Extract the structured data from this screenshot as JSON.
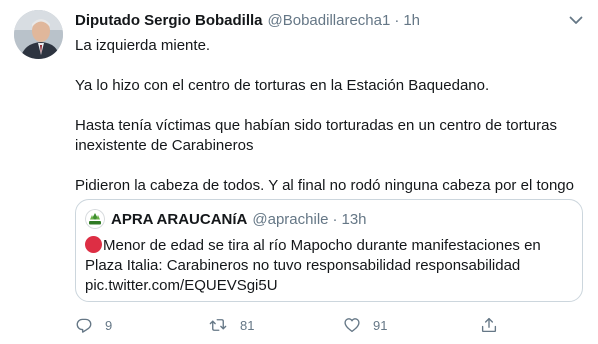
{
  "tweet": {
    "author_name": "Diputado Sergio Bobadilla",
    "author_handle": "@Bobadillarecha1",
    "separator": "·",
    "time": "1h",
    "paragraphs": [
      "La izquierda miente.",
      "Ya lo hizo con el centro de torturas en la Estación Baquedano.",
      "Hasta tenía víctimas que habían sido torturadas en un centro de torturas inexistente de Carabineros",
      "Pidieron la cabeza de todos. Y al final no rodó ninguna cabeza por el tongo"
    ]
  },
  "quote": {
    "author_name": "APRA ARAUCANíA",
    "author_handle": "@aprachile",
    "separator": "·",
    "time": "13h",
    "text": "Menor de edad se tira al río Mapocho durante manifestaciones en Plaza Italia: Carabineros no tuvo responsabilidad  responsabilidad pic.twitter.com/EQUEVSgi5U"
  },
  "actions": {
    "reply_count": "9",
    "retweet_count": "81",
    "like_count": "91"
  },
  "colors": {
    "text": "#14171a",
    "secondary": "#657786",
    "border": "#ccd6dd",
    "red_circle": "#dd2e44"
  }
}
